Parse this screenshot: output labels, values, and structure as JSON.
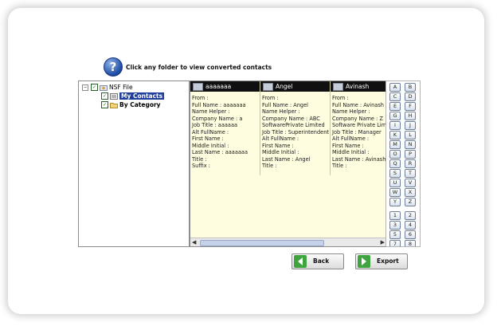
{
  "header": {
    "help_icon_glyph": "?",
    "instruction": "Click any folder to view converted contacts"
  },
  "tree": {
    "root": {
      "toggle": "−",
      "label": "NSF File"
    },
    "items": [
      {
        "label": "My Contacts",
        "selected": true
      },
      {
        "label": "By Category",
        "selected": false
      }
    ]
  },
  "contacts": [
    {
      "name": "aaaaaaa",
      "fields": [
        "From :",
        "Full Name : aaaaaaa",
        "Name Helper :",
        "Company Name : a",
        "Job Title : aaaaaa",
        "Alt FullName :",
        "First Name :",
        "Middle Initial :",
        "Last Name : aaaaaaa",
        "Title :",
        "Suffix :"
      ]
    },
    {
      "name": "Angel",
      "fields": [
        "From :",
        "Full Name : Angel",
        "Name Helper :",
        "Company Name : ABC",
        "SoftwarePrivate Limited",
        "Job Title : Superintendent",
        "Alt FullName :",
        "First Name :",
        "Middle Initial :",
        "Last Name : Angel",
        "Title :"
      ]
    },
    {
      "name": "Avinash",
      "fields": [
        "From :",
        "Full Name : Avinash",
        "Name Helper :",
        "Company Name : Z",
        "Software Private Limited",
        "Job Title : Manager",
        "Alt FullName :",
        "First Name :",
        "Middle Initial :",
        "Last Name : Avinash",
        "Title :"
      ]
    }
  ],
  "letter_buttons": [
    "A",
    "B",
    "C",
    "D",
    "E",
    "F",
    "G",
    "H",
    "I",
    "J",
    "K",
    "L",
    "M",
    "N",
    "O",
    "P",
    "Q",
    "R",
    "S",
    "T",
    "U",
    "V",
    "W",
    "X",
    "Y",
    "Z"
  ],
  "number_buttons": [
    "1",
    "2",
    "3",
    "4",
    "5",
    "6",
    "7",
    "8"
  ],
  "buttons": {
    "back": "Back",
    "export": "Export"
  }
}
